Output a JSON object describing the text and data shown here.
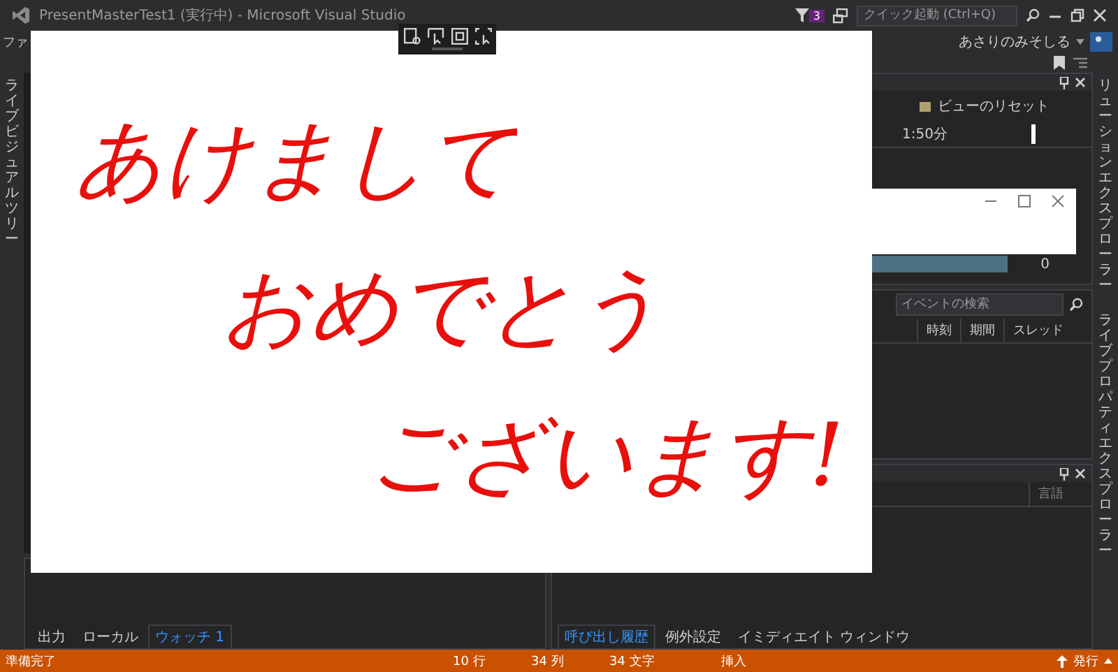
{
  "window": {
    "title": "PresentMasterTest1 (実行中) - Microsoft Visual Studio",
    "notification_count": "3",
    "quick_launch": {
      "placeholder": "クイック起動 (Ctrl+Q)"
    }
  },
  "menu": {
    "partial_item": "ファ",
    "user": "あさりのみそしる"
  },
  "left_tool_strip": [
    "ライブビジュアルツリー"
  ],
  "right_tool_strip": [
    "リューションエクスプローラー",
    "ライブプロパティエクスプローラー"
  ],
  "diagnostics": {
    "reset_view": "ビューのリセット",
    "ruler_label": "1:50分",
    "reading": "0"
  },
  "events": {
    "search": {
      "placeholder": "イベントの検索"
    },
    "columns": [
      "時刻",
      "期間",
      "スレッド"
    ]
  },
  "call_stack": {
    "columns": [
      "言語"
    ]
  },
  "bottom_left_tabs": [
    {
      "label": "出力",
      "selected": false
    },
    {
      "label": "ローカル",
      "selected": false
    },
    {
      "label": "ウォッチ 1",
      "selected": true
    }
  ],
  "bottom_right_tabs": [
    {
      "label": "呼び出し履歴",
      "selected": true
    },
    {
      "label": "例外設定",
      "selected": false
    },
    {
      "label": "イミディエイト ウィンドウ",
      "selected": false
    }
  ],
  "whiteboard": {
    "lines": [
      "あけまして",
      "おめでとう",
      "ございます!"
    ]
  },
  "status_bar": {
    "items": [
      "準備完了",
      "10 行",
      "34 列",
      "34 文字",
      "挿入"
    ],
    "publish": "発行"
  }
}
